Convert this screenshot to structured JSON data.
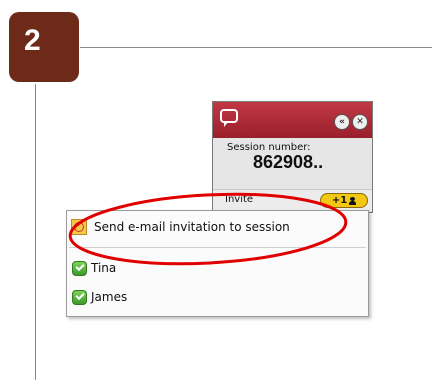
{
  "step": {
    "number": "2"
  },
  "session_panel": {
    "collapse_button": "«",
    "close_button": "✕",
    "session_label": "Session number:",
    "session_number": "862908..",
    "invite_label": "Invite",
    "invite_button": "+1"
  },
  "menu": {
    "email_item": "Send e-mail invitation to session",
    "contacts": [
      {
        "name": "Tina"
      },
      {
        "name": "James"
      }
    ]
  },
  "highlight": {
    "color": "#e00000"
  },
  "colors": {
    "badge": "#6e2a18",
    "panel_header": "#b02a36",
    "invite_button": "#f3c812",
    "contact_green": "#4fae34"
  }
}
